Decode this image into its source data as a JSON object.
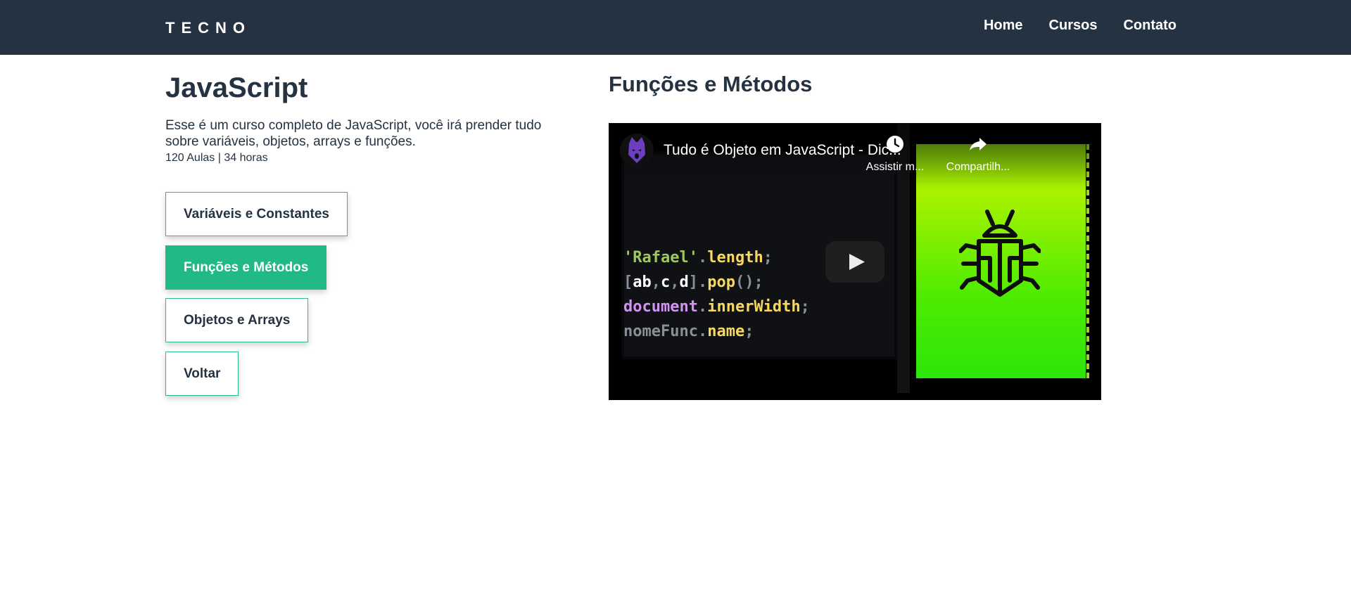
{
  "header": {
    "logo": "TECNO",
    "nav": [
      "Home",
      "Cursos",
      "Contato"
    ]
  },
  "course": {
    "title": "JavaScript",
    "description": "Esse é um curso completo de JavaScript, você irá prender tudo sobre variáveis, objetos, arrays e funções.",
    "meta": "120 Aulas | 34 horas"
  },
  "modules": [
    "Variáveis e Constantes",
    "Funções e Métodos",
    "Objetos e Arrays",
    "Voltar"
  ],
  "active_module": "Funções e Métodos",
  "lesson": {
    "title": "Funções e Métodos"
  },
  "video": {
    "title": "Tudo é Objeto em JavaScript - Dic...",
    "watch_later": "Assistir m...",
    "share": "Compartilh...",
    "code": {
      "s1": "'Rafael'",
      "d1": ".",
      "m1": "length",
      "e1": ";",
      "b1": "[",
      "v1": "ab",
      "c1": ",",
      "v2": "c",
      "c2": ",",
      "v3": "d",
      "b2": "]",
      "d2": ".",
      "m2": "pop",
      "e2": "();",
      "o1": "document",
      "d3": ".",
      "m3": "innerWidth",
      "e3": ";",
      "o2": "nomeFunc",
      "d4": ".",
      "m4": "name",
      "e4": ";"
    }
  },
  "colors": {
    "header_bg": "#253241",
    "accent": "#22b988",
    "text": "#253241"
  },
  "icons": {
    "play": "play-icon",
    "watch_later": "clock-icon",
    "share": "share-icon",
    "channel": "wolf-avatar-icon",
    "bug": "bug-icon"
  }
}
